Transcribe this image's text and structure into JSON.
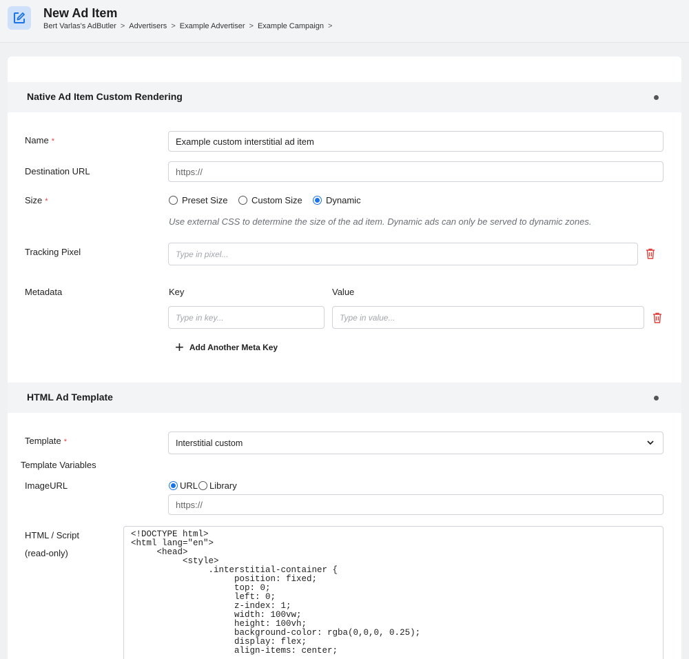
{
  "header": {
    "title": "New Ad Item",
    "breadcrumb": [
      "Bert Varlas's AdButler",
      "Advertisers",
      "Example Advertiser",
      "Example Campaign"
    ],
    "separator": ">"
  },
  "section_native": {
    "title": "Native Ad Item Custom Rendering",
    "name": {
      "label": "Name",
      "required": "*",
      "value": "Example custom interstitial ad item"
    },
    "destination": {
      "label": "Destination URL",
      "value": "https://"
    },
    "size": {
      "label": "Size",
      "required": "*",
      "options": [
        "Preset Size",
        "Custom Size",
        "Dynamic"
      ],
      "selected": "Dynamic",
      "hint": "Use external CSS to determine the size of the ad item. Dynamic ads can only be served to dynamic zones."
    },
    "tracking": {
      "label": "Tracking Pixel",
      "placeholder": "Type in pixel..."
    },
    "metadata": {
      "label": "Metadata",
      "key_header": "Key",
      "value_header": "Value",
      "key_placeholder": "Type in key...",
      "value_placeholder": "Type in value...",
      "add_label": "Add Another Meta Key"
    }
  },
  "section_template": {
    "title": "HTML Ad Template",
    "template": {
      "label": "Template",
      "required": "*",
      "value": "Interstitial custom"
    },
    "variables_label": "Template Variables",
    "image_url": {
      "label": "ImageURL",
      "options": [
        "URL",
        "Library"
      ],
      "selected": "URL",
      "value": "https://"
    },
    "html_script": {
      "label": "HTML / Script",
      "sublabel": "(read-only)",
      "code": "<!DOCTYPE html>\n<html lang=\"en\">\n     <head>\n          <style>\n               .interstitial-container {\n                    position: fixed;\n                    top: 0;\n                    left: 0;\n                    z-index: 1;\n                    width: 100vw;\n                    height: 100vh;\n                    background-color: rgba(0,0,0, 0.25);\n                    display: flex;\n                    align-items: center;"
    }
  },
  "colors": {
    "accent": "#1a73e8",
    "danger": "#e0413a",
    "icon_bg": "#cfe0fb"
  }
}
